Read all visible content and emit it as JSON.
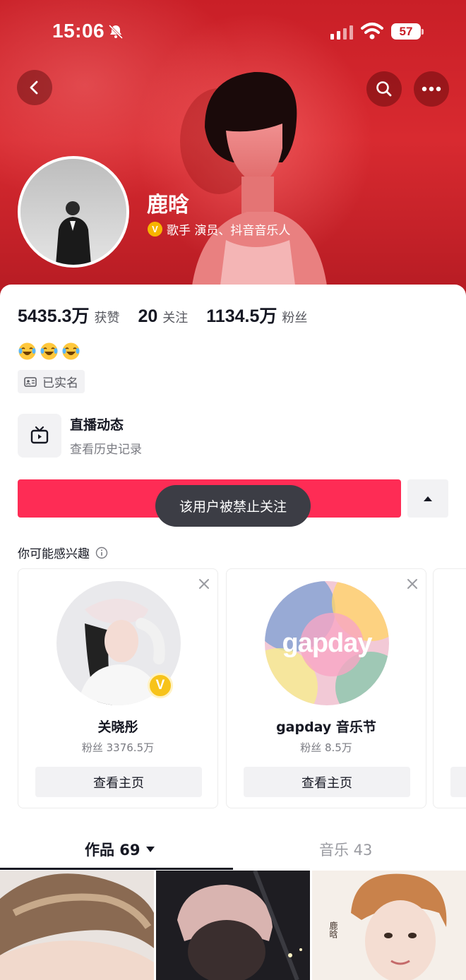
{
  "status_bar": {
    "time": "15:06",
    "battery": "57"
  },
  "profile": {
    "name": "鹿晗",
    "verification": "歌手 演员、抖音音乐人"
  },
  "stats": [
    {
      "value": "5435.3万",
      "label": "获赞"
    },
    {
      "value": "20",
      "label": "关注"
    },
    {
      "value": "1134.5万",
      "label": "粉丝"
    }
  ],
  "bio_emoji": [
    "laughing-crying-emoji",
    "laughing-crying-emoji",
    "laughing-crying-emoji"
  ],
  "realname_tag": "已实名",
  "live": {
    "title": "直播动态",
    "subtitle": "查看历史记录"
  },
  "toast": "该用户被禁止关注",
  "suggestions": {
    "title": "你可能感兴趣",
    "cards": [
      {
        "name": "关晓彤",
        "fans": "粉丝 3376.5万",
        "button": "查看主页",
        "verified": true
      },
      {
        "name": "gapday 音乐节",
        "fans": "粉丝 8.5万",
        "button": "查看主页",
        "verified": false
      }
    ]
  },
  "tabs": [
    {
      "label": "作品 69",
      "active": true
    },
    {
      "label": "音乐 43",
      "active": false
    }
  ],
  "thumbnails": [
    {
      "overlay_text": ""
    },
    {
      "overlay_text": ""
    },
    {
      "overlay_text": "鹿晗"
    }
  ],
  "colors": {
    "header_red": "#c91f27",
    "follow_button": "#fe2c55",
    "verify_gold": "#f7b500",
    "toast_bg": "#3c3d45"
  }
}
